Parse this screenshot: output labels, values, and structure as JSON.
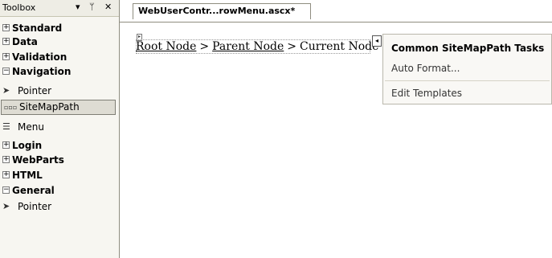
{
  "toolbox": {
    "title": "Toolbox",
    "header_icons": [
      "dropdown-arrow-icon",
      "pin-icon",
      "close-icon"
    ],
    "groups_top": [
      {
        "label": "Standard",
        "expander": "+"
      },
      {
        "label": "Data",
        "expander": "+"
      },
      {
        "label": "Validation",
        "expander": "+"
      },
      {
        "label": "Navigation",
        "expander": "-"
      }
    ],
    "navigation_items": [
      {
        "label": "Pointer",
        "icon": "pointer-icon"
      },
      {
        "label": "SiteMapPath",
        "icon": "sitemappath-icon",
        "selected": true
      },
      {
        "label": "Menu",
        "icon": "menu-icon"
      }
    ],
    "groups_bottom": [
      {
        "label": "Login",
        "expander": "+"
      },
      {
        "label": "WebParts",
        "expander": "+"
      },
      {
        "label": "HTML",
        "expander": "+"
      },
      {
        "label": "General",
        "expander": "-"
      }
    ],
    "general_items": [
      {
        "label": "Pointer",
        "icon": "pointer-icon"
      }
    ]
  },
  "document": {
    "tab_label": "WebUserContr...rowMenu.ascx*"
  },
  "breadcrumb": {
    "root": "Root Node",
    "separator": ">",
    "parent": "Parent Node",
    "current": "Current Node"
  },
  "task_panel": {
    "title": "Common SiteMapPath Tasks",
    "items": [
      "Auto Format...",
      "Edit Templates"
    ]
  }
}
